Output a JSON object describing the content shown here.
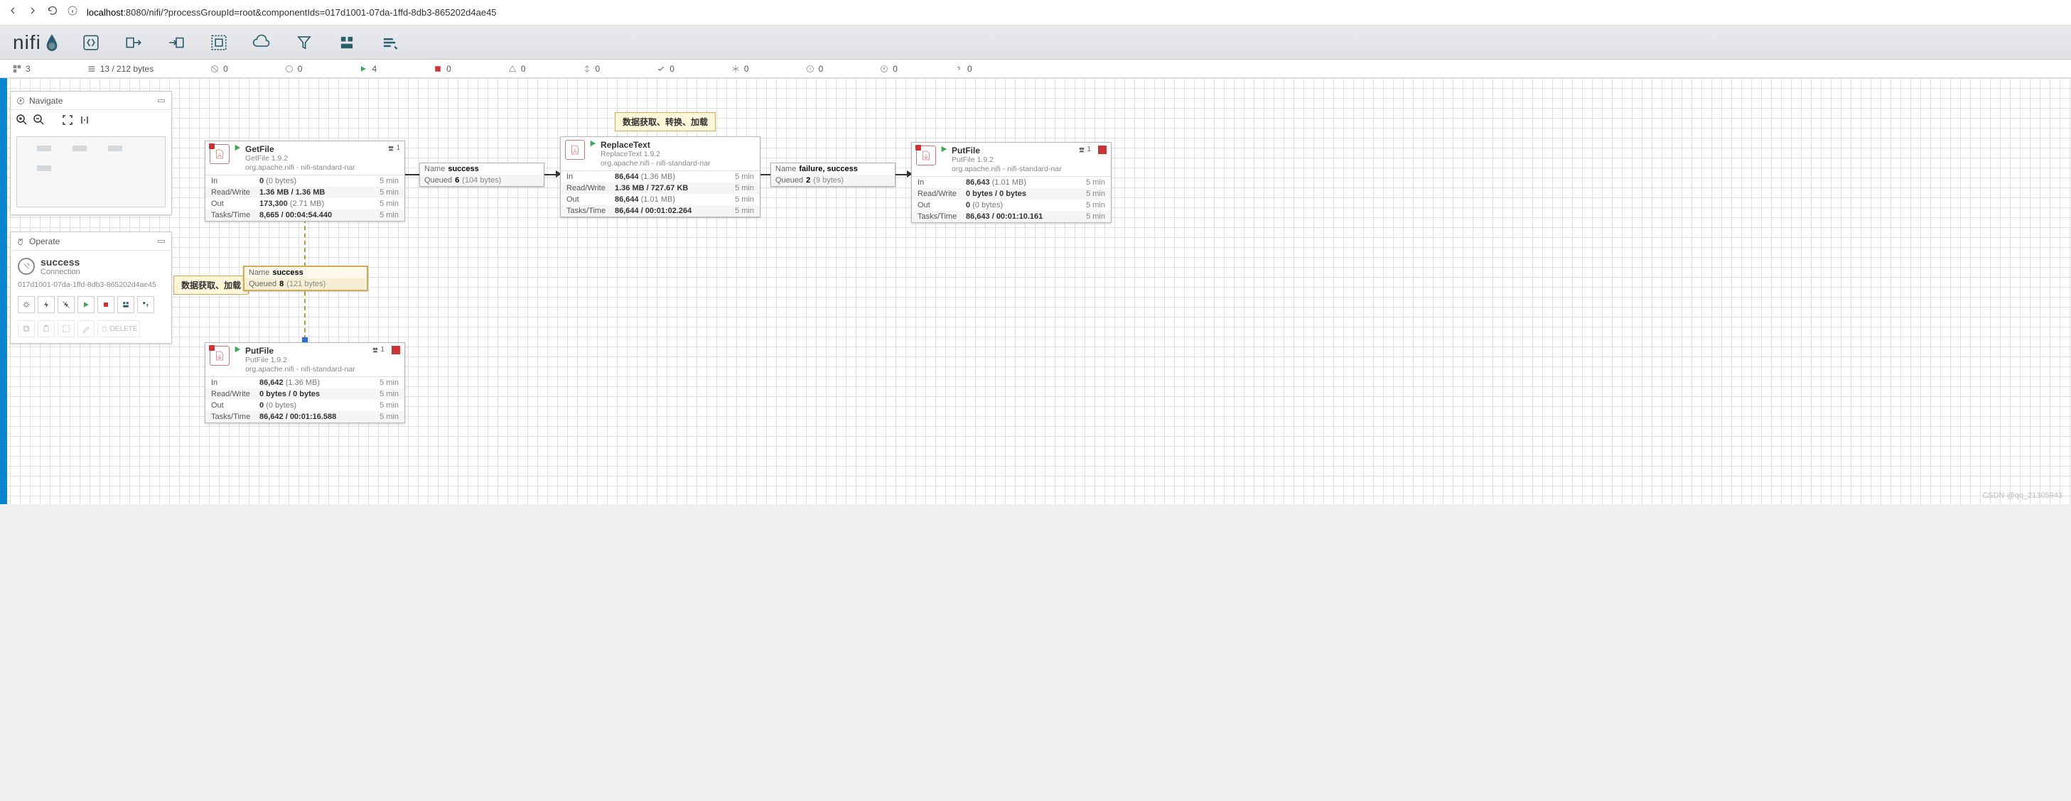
{
  "browser": {
    "url_prefix": "localhost",
    "url_rest": ":8080/nifi/?processGroupId=root&componentIds=017d1001-07da-1ffd-8db3-865202d4ae45"
  },
  "status": {
    "groups": "3",
    "queue": "13 / 212 bytes",
    "disabled": "0",
    "invalid": "0",
    "running": "4",
    "stopped": "0",
    "warning": "0",
    "transmitting": "0",
    "checkmark": "0",
    "snowflake": "0",
    "clock": "0",
    "bulletin": "0",
    "question": "0"
  },
  "navigate": {
    "title": "Navigate"
  },
  "operate": {
    "title": "Operate",
    "name": "success",
    "type": "Connection",
    "id": "017d1001-07da-1ffd-8db3-865202d4ae45",
    "delete": "DELETE"
  },
  "labels": {
    "label1": "数据获取、加载",
    "label2": "数据获取、转换、加载"
  },
  "processors": {
    "getfile": {
      "name": "GetFile",
      "sub1": "GetFile 1.9.2",
      "sub2": "org.apache.nifi - nifi-standard-nar",
      "threads": "1",
      "in_v": "0",
      "in_p": "(0 bytes)",
      "in_m": "5 min",
      "rw_v": "1.36 MB / 1.36 MB",
      "rw_m": "5 min",
      "out_v": "173,300",
      "out_p": "(2.71 MB)",
      "out_m": "5 min",
      "tt_v": "8,665 / 00:04:54.440",
      "tt_m": "5 min"
    },
    "replacetext": {
      "name": "ReplaceText",
      "sub1": "ReplaceText 1.9.2",
      "sub2": "org.apache.nifi - nifi-standard-nar",
      "in_v": "86,644",
      "in_p": "(1.36 MB)",
      "in_m": "5 min",
      "rw_v": "1.36 MB / 727.67 KB",
      "rw_m": "5 min",
      "out_v": "86,644",
      "out_p": "(1.01 MB)",
      "out_m": "5 min",
      "tt_v": "86,644 / 00:01:02.264",
      "tt_m": "5 min"
    },
    "putfile1": {
      "name": "PutFile",
      "sub1": "PutFile 1.9.2",
      "sub2": "org.apache.nifi - nifi-standard-nar",
      "threads": "1",
      "in_v": "86,642",
      "in_p": "(1.36 MB)",
      "in_m": "5 min",
      "rw_v": "0 bytes / 0 bytes",
      "rw_m": "5 min",
      "out_v": "0",
      "out_p": "(0 bytes)",
      "out_m": "5 min",
      "tt_v": "86,642 / 00:01:16.588",
      "tt_m": "5 min"
    },
    "putfile2": {
      "name": "PutFile",
      "sub1": "PutFile 1.9.2",
      "sub2": "org.apache.nifi - nifi-standard-nar",
      "threads": "1",
      "in_v": "86,643",
      "in_p": "(1.01 MB)",
      "in_m": "5 min",
      "rw_v": "0 bytes / 0 bytes",
      "rw_m": "5 min",
      "out_v": "0",
      "out_p": "(0 bytes)",
      "out_m": "5 min",
      "tt_v": "86,643 / 00:01:10.161",
      "tt_m": "5 min"
    }
  },
  "stat_labels": {
    "in": "In",
    "rw": "Read/Write",
    "out": "Out",
    "tt": "Tasks/Time"
  },
  "connections": {
    "c1": {
      "name_lbl": "Name",
      "name": "success",
      "q_lbl": "Queued",
      "q_v": "6",
      "q_p": "(104 bytes)"
    },
    "c2": {
      "name_lbl": "Name",
      "name": "success",
      "q_lbl": "Queued",
      "q_v": "8",
      "q_p": "(121 bytes)"
    },
    "c3": {
      "name_lbl": "Name",
      "name": "failure, success",
      "q_lbl": "Queued",
      "q_v": "2",
      "q_p": "(9 bytes)"
    }
  },
  "watermark": "CSDN @qq_21305943"
}
